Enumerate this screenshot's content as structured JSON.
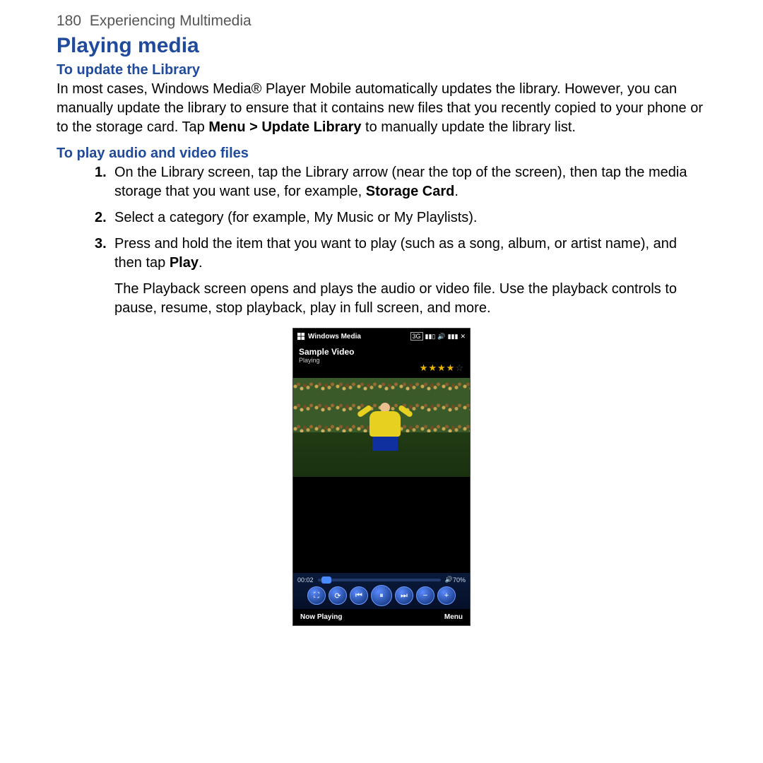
{
  "header": {
    "page_number": "180",
    "chapter": "Experiencing Multimedia"
  },
  "title": "Playing media",
  "section1": {
    "heading": "To update the Library",
    "para_a": "In most cases, Windows Media® Player Mobile automatically updates the library. However, you can manually update the library to ensure that it contains new files that you recently copied to your phone or to the storage card. Tap ",
    "bold1": "Menu > Update Library",
    "para_b": " to manually update the library list."
  },
  "section2": {
    "heading": "To play audio and video files",
    "step1_a": "On the Library screen, tap the Library arrow (near the top of the screen), then tap the media storage that you want use, for example, ",
    "step1_bold": "Storage Card",
    "step1_b": ".",
    "step2": "Select a category (for example, My Music or My Playlists).",
    "step3_a": "Press and hold the item that you want to play (such as a song, album, or artist name), and then tap ",
    "step3_bold": "Play",
    "step3_b": ".",
    "after": "The Playback screen opens and plays the audio or video file. Use the playback controls to pause, resume, stop playback, play in full screen, and more."
  },
  "phone": {
    "statusbar_title": "Windows Media",
    "badge_3g": "3G",
    "media_title": "Sample Video",
    "media_status": "Playing",
    "rating": 4,
    "rating_max": 5,
    "time_elapsed": "00:02",
    "volume_pct": "70%",
    "softkey_left": "Now Playing",
    "softkey_right": "Menu"
  }
}
